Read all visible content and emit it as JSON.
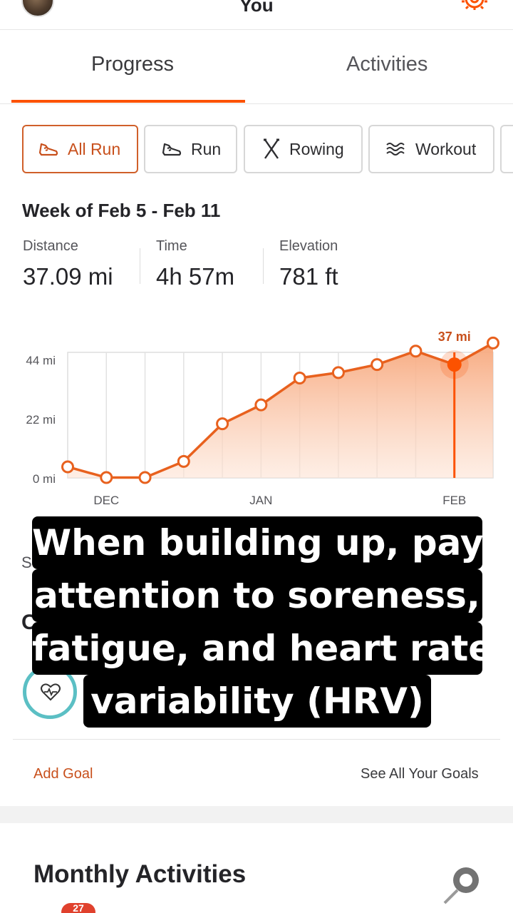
{
  "header": {
    "title": "You"
  },
  "tabs": [
    {
      "label": "Progress",
      "active": true
    },
    {
      "label": "Activities",
      "active": false
    }
  ],
  "sport_chips": [
    {
      "label": "All Run",
      "icon": "shoe-icon",
      "selected": true
    },
    {
      "label": "Run",
      "icon": "shoe-icon"
    },
    {
      "label": "Rowing",
      "icon": "oars-icon"
    },
    {
      "label": "Workout",
      "icon": "workout-wave-icon"
    }
  ],
  "week": {
    "title": "Week of Feb 5 - Feb 11",
    "stats": [
      {
        "label": "Distance",
        "value": "37.09 mi"
      },
      {
        "label": "Time",
        "value": "4h 57m"
      },
      {
        "label": "Elevation",
        "value": "781 ft"
      }
    ]
  },
  "chart_data": {
    "type": "area",
    "y_tick_labels": [
      "44 mi",
      "22 mi",
      "0 mi"
    ],
    "y_ticks": [
      44,
      22,
      0
    ],
    "ylim": [
      0,
      44
    ],
    "x_tick_labels": [
      {
        "label": "DEC",
        "index": 1
      },
      {
        "label": "JAN",
        "index": 5
      },
      {
        "label": "FEB",
        "index": 10
      }
    ],
    "values": [
      2,
      -2,
      -2,
      4,
      18,
      25,
      35,
      37,
      40,
      45,
      40,
      48
    ],
    "highlight": {
      "index": 10,
      "label": "37 mi"
    },
    "colors": {
      "line": "#e8611e",
      "highlight": "#fc5200",
      "fill_top": "#f7a67a"
    }
  },
  "goals": {
    "section_fragment": "S",
    "title_fragment": "C",
    "icon": "heart-pulse-icon",
    "add_goal_label": "Add Goal",
    "see_all_label": "See All Your Goals"
  },
  "caption": {
    "lines": [
      "When building up, pay",
      "attention to soreness,",
      "fatigue, and heart rate",
      "variability (HRV)"
    ]
  },
  "monthly": {
    "title": "Monthly Activities"
  },
  "nav": {
    "badge": "27"
  },
  "colors": {
    "accent": "#fc5200",
    "teal": "#5bbfc4"
  }
}
